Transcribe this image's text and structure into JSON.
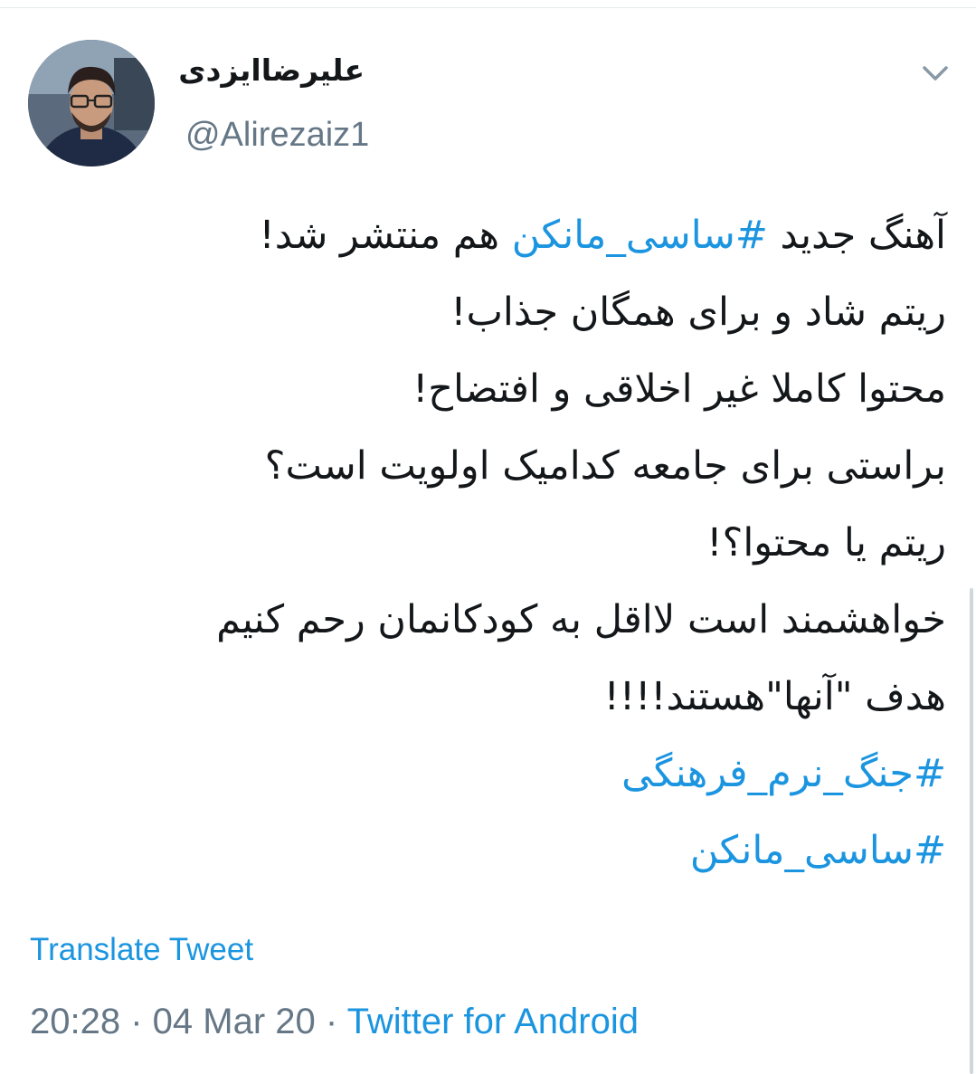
{
  "user": {
    "display_name": "علیرضاایزدی",
    "handle": "@Alirezaiz1"
  },
  "tweet": {
    "lines": [
      {
        "type": "mixed",
        "before": "آهنگ جدید ",
        "hashtag": "#ساسی_مانکن",
        "after": " هم منتشر شد!"
      },
      {
        "type": "text",
        "text": "ریتم شاد و برای همگان جذاب!"
      },
      {
        "type": "text",
        "text": "محتوا کاملا غیر اخلاقی و افتضاح!"
      },
      {
        "type": "text",
        "text": "براستی برای جامعه کدامیک اولویت است؟"
      },
      {
        "type": "text",
        "text": "ریتم یا محتوا؟!"
      },
      {
        "type": "text",
        "text": "خواهشمند است لااقل به کودکانمان رحم کنیم"
      },
      {
        "type": "text",
        "text": "هدف \"آنها\"هستند!!!!"
      },
      {
        "type": "hashtag",
        "text": "#جنگ_نرم_فرهنگی"
      },
      {
        "type": "hashtag",
        "text": "#ساسی_مانکن"
      }
    ]
  },
  "translate_label": "Translate Tweet",
  "meta": {
    "time": "20:28",
    "separator": " · ",
    "date": "04 Mar 20",
    "source": "Twitter for Android"
  },
  "icons": {
    "caret": "chevron-down-icon",
    "avatar": "avatar"
  },
  "colors": {
    "link": "#1b95e0",
    "text": "#14171a",
    "secondary": "#657786"
  }
}
